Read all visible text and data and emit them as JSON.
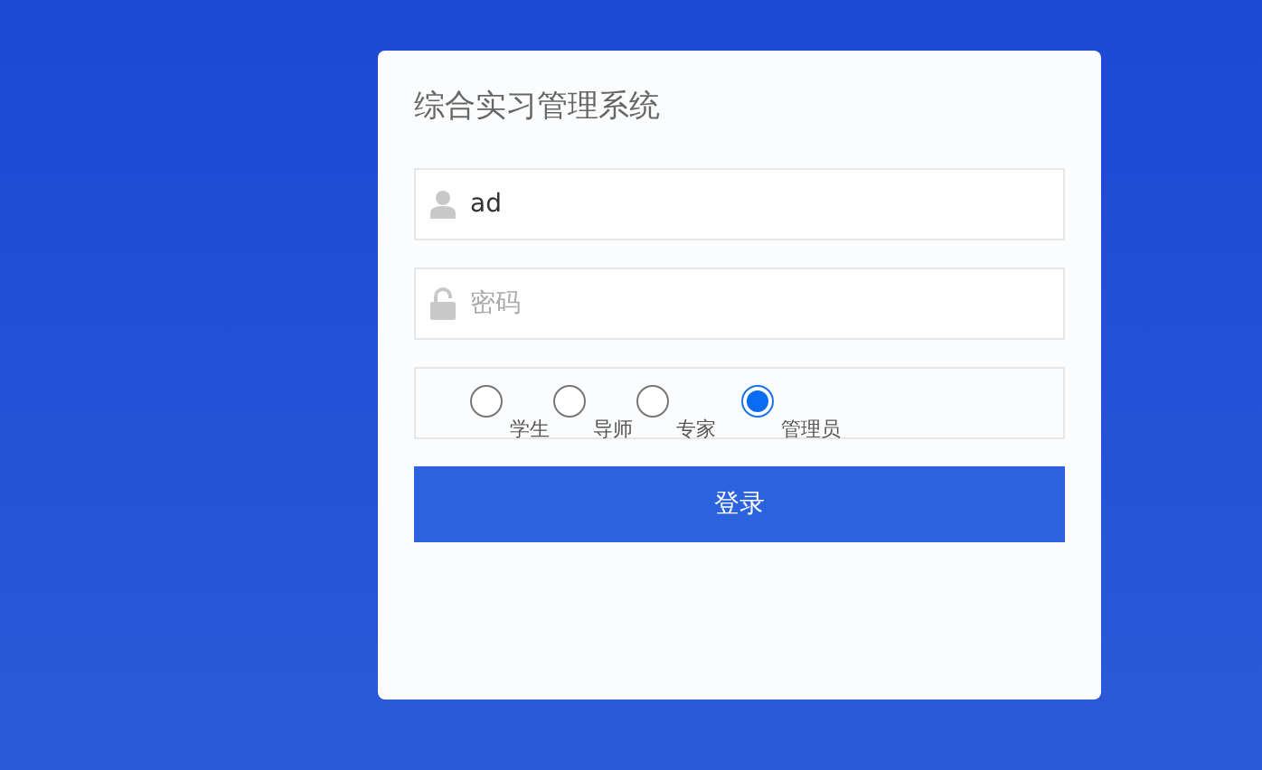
{
  "title": "综合实习管理系统",
  "username": {
    "value": "ad"
  },
  "password": {
    "placeholder": "密码"
  },
  "roles": [
    {
      "label": "学生",
      "selected": false
    },
    {
      "label": "导师",
      "selected": false
    },
    {
      "label": "专家",
      "selected": false
    },
    {
      "label": "管理员",
      "selected": true
    }
  ],
  "login_button": "登录"
}
